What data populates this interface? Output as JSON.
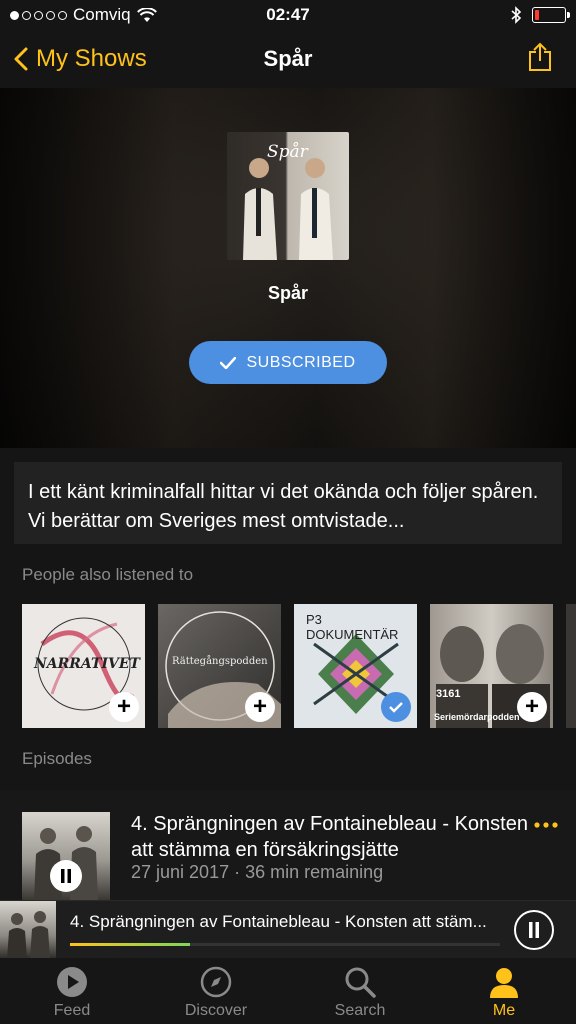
{
  "status": {
    "carrier": "Comviq",
    "time": "02:47",
    "signal_bars": 1,
    "battery_level": 0.08
  },
  "nav": {
    "back_label": "My Shows",
    "title": "Spår"
  },
  "show": {
    "title": "Spår",
    "artwork_logo": "Spår",
    "subscribe_label": "SUBSCRIBED",
    "description": "I ett känt kriminalfall hittar vi det okända och följer spåren. Vi berättar om Sveriges mest omtvistade..."
  },
  "recommendations": {
    "heading": "People also listened to",
    "items": [
      {
        "title": "NARRATIVET",
        "subscribed": false
      },
      {
        "title": "Rättegångspodden",
        "subscribed": false
      },
      {
        "title": "P3 DOKUMENTÄR",
        "subscribed": true
      },
      {
        "title": "Seriemördarpodden",
        "badge": "3161",
        "subscribed": false
      }
    ]
  },
  "episodes": {
    "heading": "Episodes",
    "items": [
      {
        "title": "4. Sprängningen av Fontainebleau - Konsten att stämma en försäkringsjätte",
        "meta": "27 juni 2017 · 36 min remaining"
      }
    ]
  },
  "player": {
    "now_playing": "4. Sprängningen av Fontainebleau - Konsten att stäm...",
    "progress": 0.28
  },
  "tabs": [
    {
      "label": "Feed",
      "icon": "play-circle-icon",
      "active": false
    },
    {
      "label": "Discover",
      "icon": "compass-icon",
      "active": false
    },
    {
      "label": "Search",
      "icon": "search-icon",
      "active": false
    },
    {
      "label": "Me",
      "icon": "person-icon",
      "active": true
    }
  ],
  "colors": {
    "accent": "#ffc21a",
    "subscribed": "#4d8fe0",
    "background": "#151515"
  }
}
